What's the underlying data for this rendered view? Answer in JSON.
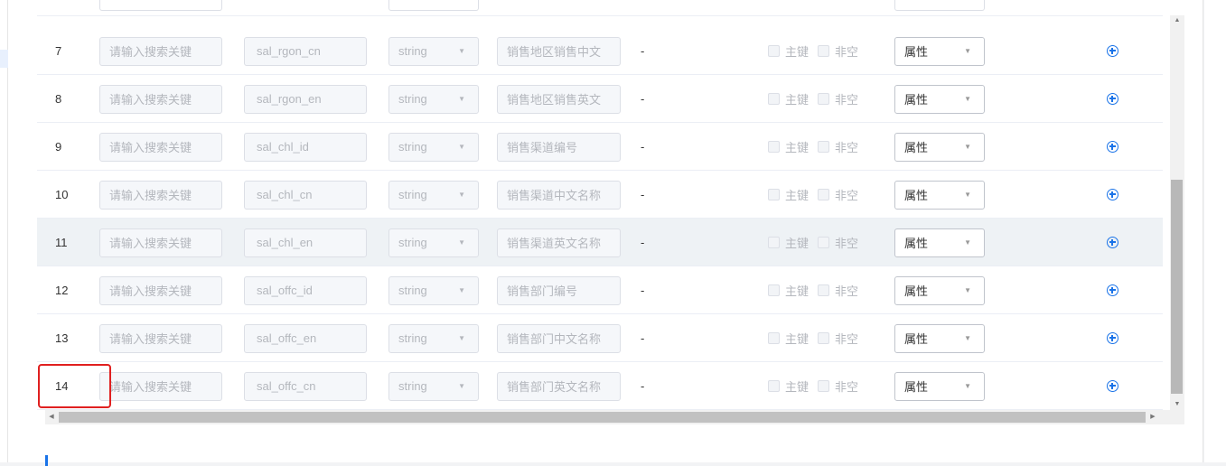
{
  "table": {
    "rows": [
      {
        "index": "7",
        "search_placeholder": "请输入搜索关键",
        "code": "sal_rgon_cn",
        "type": "string",
        "name": "销售地区销售中文",
        "dash": "-",
        "pk_label": "主键",
        "nn_label": "非空",
        "attr": "属性",
        "highlighted": false
      },
      {
        "index": "8",
        "search_placeholder": "请输入搜索关键",
        "code": "sal_rgon_en",
        "type": "string",
        "name": "销售地区销售英文",
        "dash": "-",
        "pk_label": "主键",
        "nn_label": "非空",
        "attr": "属性",
        "highlighted": false
      },
      {
        "index": "9",
        "search_placeholder": "请输入搜索关键",
        "code": "sal_chl_id",
        "type": "string",
        "name": "销售渠道编号",
        "dash": "-",
        "pk_label": "主键",
        "nn_label": "非空",
        "attr": "属性",
        "highlighted": false
      },
      {
        "index": "10",
        "search_placeholder": "请输入搜索关键",
        "code": "sal_chl_cn",
        "type": "string",
        "name": "销售渠道中文名称",
        "dash": "-",
        "pk_label": "主键",
        "nn_label": "非空",
        "attr": "属性",
        "highlighted": false
      },
      {
        "index": "11",
        "search_placeholder": "请输入搜索关键",
        "code": "sal_chl_en",
        "type": "string",
        "name": "销售渠道英文名称",
        "dash": "-",
        "pk_label": "主键",
        "nn_label": "非空",
        "attr": "属性",
        "highlighted": true
      },
      {
        "index": "12",
        "search_placeholder": "请输入搜索关键",
        "code": "sal_offc_id",
        "type": "string",
        "name": "销售部门编号",
        "dash": "-",
        "pk_label": "主键",
        "nn_label": "非空",
        "attr": "属性",
        "highlighted": false
      },
      {
        "index": "13",
        "search_placeholder": "请输入搜索关键",
        "code": "sal_offc_en",
        "type": "string",
        "name": "销售部门中文名称",
        "dash": "-",
        "pk_label": "主键",
        "nn_label": "非空",
        "attr": "属性",
        "highlighted": false
      },
      {
        "index": "14",
        "search_placeholder": "请输入搜索关键",
        "code": "sal_offc_cn",
        "type": "string",
        "name": "销售部门英文名称",
        "dash": "-",
        "pk_label": "主键",
        "nn_label": "非空",
        "attr": "属性",
        "highlighted": false
      }
    ]
  },
  "icons": {
    "add": "add-circle-icon",
    "caret": "caret-down-icon"
  },
  "colors": {
    "accent": "#1a73e8",
    "highlight_border": "#e02020",
    "row_highlight": "#eef2f5"
  }
}
